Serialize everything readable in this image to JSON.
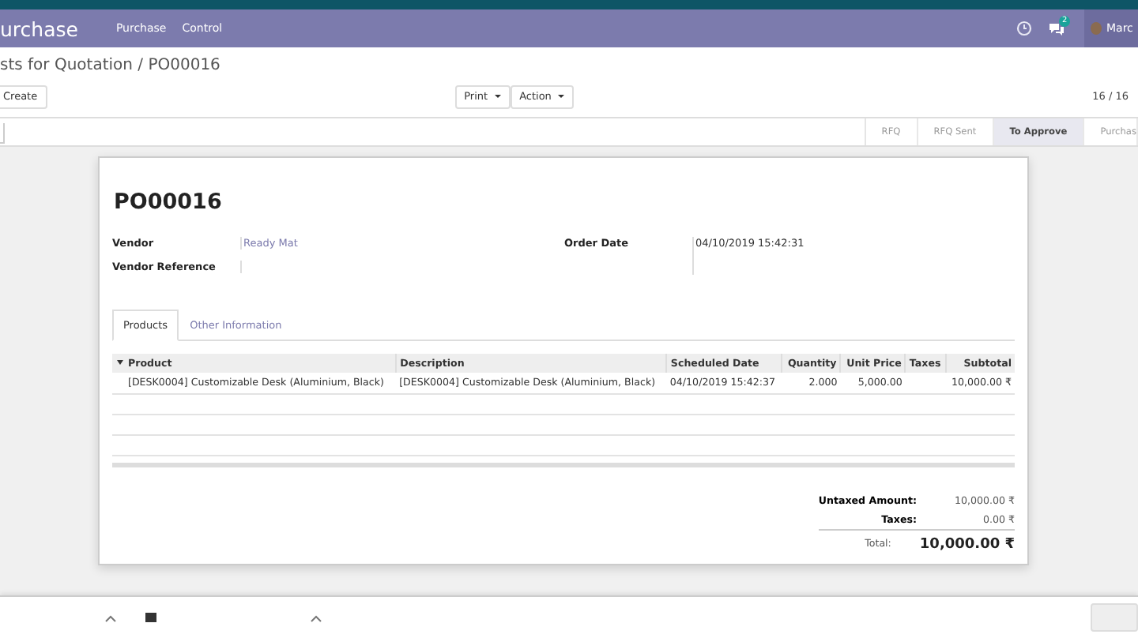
{
  "navbar": {
    "app": "urchase",
    "menus": [
      "Purchase",
      "Control"
    ],
    "chat_count": "2",
    "user": "Marc"
  },
  "breadcrumb": "sts for Quotation / PO00016",
  "buttons": {
    "create": "Create",
    "print": "Print",
    "action": "Action"
  },
  "pager": "16 / 16",
  "stages": [
    {
      "label": "RFQ",
      "selected": false
    },
    {
      "label": "RFQ Sent",
      "selected": false
    },
    {
      "label": "To Approve",
      "selected": true
    },
    {
      "label": "Purchas",
      "selected": false
    }
  ],
  "sheet": {
    "title": "PO00016",
    "fields_left": [
      {
        "label": "Vendor",
        "value": "Ready Mat"
      },
      {
        "label": "Vendor Reference"
      }
    ],
    "fields_right": [
      {
        "label": "Order Date",
        "value": "04/10/2019 15:42:31"
      }
    ],
    "tabs": [
      {
        "label": "Products",
        "selected": true
      },
      {
        "label": "Other Information",
        "selected": false
      }
    ],
    "table": {
      "columns": [
        "Product",
        "Description",
        "Scheduled Date",
        "Quantity",
        "Unit Price",
        "Taxes",
        "Subtotal"
      ],
      "rows": [
        [
          "[DESK0004] Customizable Desk (Aluminium, Black)",
          "[DESK0004] Customizable Desk (Aluminium, Black)",
          "04/10/2019 15:42:37",
          "2.000",
          "5,000.00",
          "",
          "10,000.00 ₹"
        ]
      ]
    },
    "totals": [
      {
        "label": "Untaxed Amount:",
        "value": "10,000.00 ₹",
        "kind": "sub"
      },
      {
        "label": "Taxes:",
        "value": "0.00 ₹",
        "kind": "sub"
      },
      {
        "label": "Total:",
        "value": "10,000.00 ₹",
        "kind": "total"
      }
    ]
  }
}
